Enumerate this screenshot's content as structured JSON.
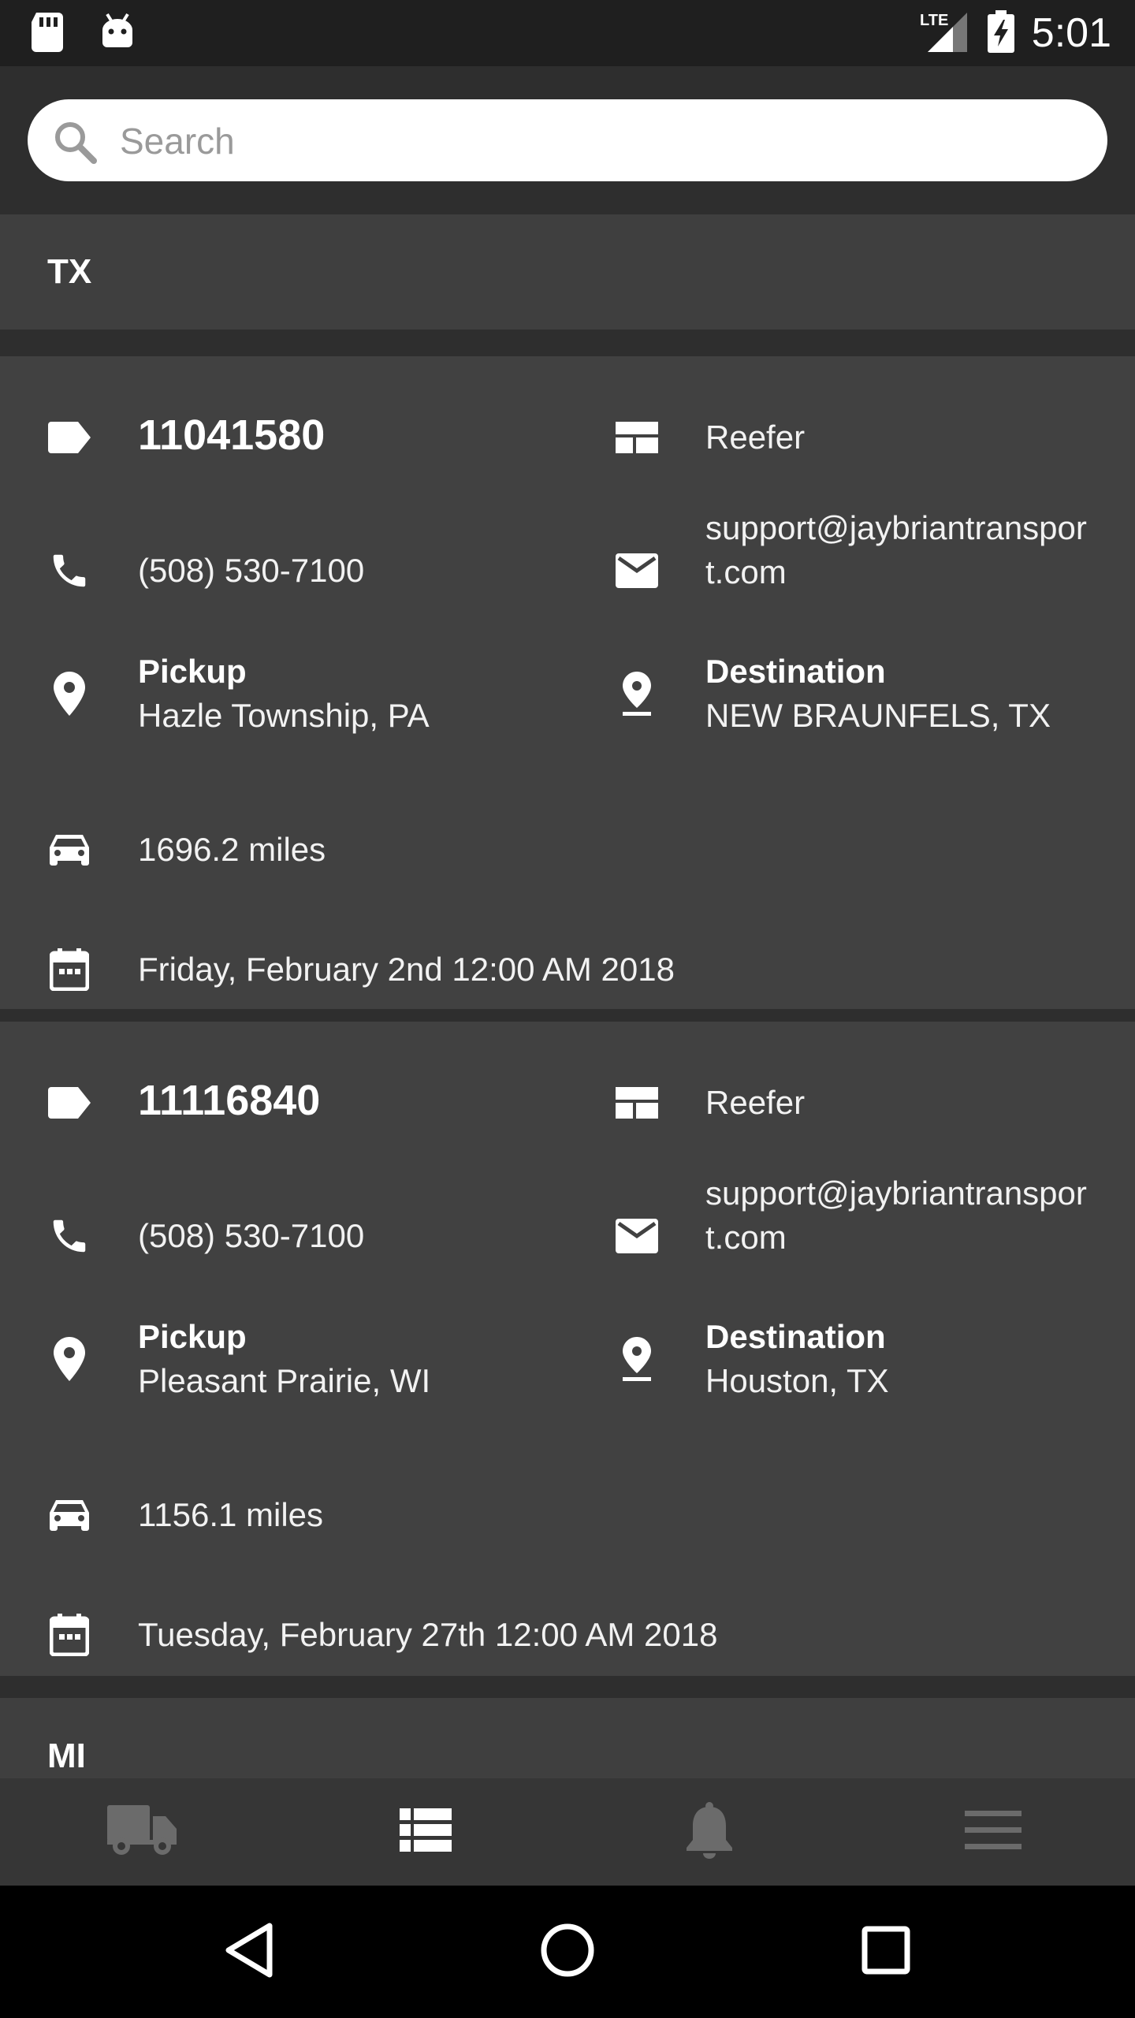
{
  "status_bar": {
    "time": "5:01",
    "network": "LTE"
  },
  "search": {
    "placeholder": "Search"
  },
  "sections": [
    {
      "title": "TX"
    },
    {
      "title": "MI"
    }
  ],
  "loads": [
    {
      "id": "11041580",
      "equipment": "Reefer",
      "phone": "(508) 530-7100",
      "email": "support@jaybriantransport.com",
      "pickup_label": "Pickup",
      "pickup": "Hazle Township, PA",
      "destination_label": "Destination",
      "destination": "NEW BRAUNFELS, TX",
      "distance": "1696.2 miles",
      "date": "Friday, February 2nd 12:00 AM 2018"
    },
    {
      "id": "11116840",
      "equipment": "Reefer",
      "phone": "(508) 530-7100",
      "email": "support@jaybriantransport.com",
      "pickup_label": "Pickup",
      "pickup": "Pleasant Prairie, WI",
      "destination_label": "Destination",
      "destination": "Houston, TX",
      "distance": "1156.1 miles",
      "date": "Tuesday, February 27th 12:00 AM 2018"
    }
  ],
  "bottom_nav": {
    "items": [
      {
        "icon": "truck-icon"
      },
      {
        "icon": "list-icon",
        "active": true
      },
      {
        "icon": "bell-icon"
      },
      {
        "icon": "hamburger-menu-icon"
      }
    ]
  },
  "colors": {
    "background": "#2e2e2e",
    "card": "#414141",
    "section_header": "#3f3f3f",
    "bottom_nav": "#363636",
    "icon_inactive": "#6b6b6b",
    "icon_active": "#ffffff"
  }
}
